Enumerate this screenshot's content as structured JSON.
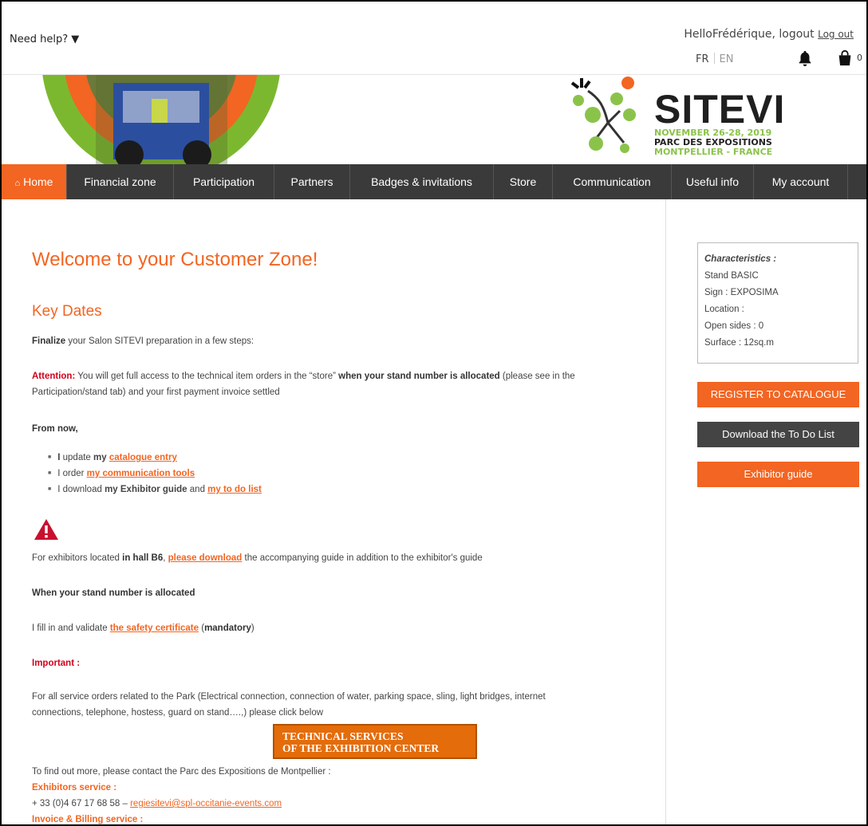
{
  "topbar": {
    "help": "Need help? ▼",
    "hello": "HelloFrédérique, logout",
    "logout": "Log out",
    "lang_fr": "FR",
    "lang_en": "EN",
    "cart_count": "0"
  },
  "logo": {
    "title": "SITEVI",
    "dates": "NOVEMBER 26-28, 2019",
    "park": "PARC DES EXPOSITIONS",
    "city": "MONTPELLIER - FRANCE"
  },
  "nav": [
    {
      "label": "Home"
    },
    {
      "label": "Financial zone"
    },
    {
      "label": "Participation"
    },
    {
      "label": "Partners"
    },
    {
      "label": "Badges & invitations"
    },
    {
      "label": "Store"
    },
    {
      "label": "Communication"
    },
    {
      "label": "Useful info"
    },
    {
      "label": "My account"
    }
  ],
  "sidebar": {
    "char_title": "Characteristics :",
    "stand": "Stand BASIC",
    "sign": "Sign : EXPOSIMA",
    "location": "Location :",
    "open_sides": "Open sides : 0",
    "surface": "Surface : 12sq.m",
    "btn_register": "REGISTER TO CATALOGUE",
    "btn_todo": "Download the To Do List",
    "btn_guide": "Exhibitor guide"
  },
  "main": {
    "welcome": "Welcome to your Customer Zone!",
    "key_dates": "Key Dates",
    "finalize_b": "Finalize",
    "finalize_rest": " your Salon SITEVI preparation in a few steps:",
    "attention_label": "Attention:",
    "attention_1": " You will get full access to the technical item orders in the “store” ",
    "attention_b": "when your stand number is allocated",
    "attention_2": " (please see in the",
    "attention_3": "Participation/stand tab) and your first payment invoice settled",
    "from_now": "From now,",
    "b1_i": "I",
    "b1_mid": " update ",
    "b1_my": "my",
    "b1_link": "catalogue entry",
    "b2_pre": "I order ",
    "b2_link": "my communication tools",
    "b3_pre": "I download ",
    "b3_b": "my Exhibitor guide",
    "b3_and": " and ",
    "b3_link": "my to do list",
    "b6_pre": "For exhibitors located ",
    "b6_b": "in hall B6",
    "b6_comma": ", ",
    "b6_link": "please download",
    "b6_rest": " the accompanying guide in addition to the exhibitor's guide",
    "allocated": "When your stand number is allocated",
    "fill_pre": "I fill in and validate ",
    "fill_link": "the safety certificate",
    "fill_mid": " (",
    "fill_b": "mandatory",
    "fill_end": ")",
    "important": "Important :",
    "service_1": "For all service orders related to the Park (Electrical connection, connection of water, parking space, sling, light bridges, internet",
    "service_2": "connections, telephone, hostess, guard on stand….,) please click below",
    "tech_1": "TECHNICAL SERVICES",
    "tech_2": "OF THE EXHIBITION CENTER",
    "contact": "To find out more, please contact the Parc des Expositions de Montpellier :",
    "exh_service": "Exhibitors service :",
    "phone": "+ 33 (0)4 67 17 68 58 – ",
    "email": "regiesitevi@spl-occitanie-events.com",
    "invoice": "Invoice & Billing service :"
  }
}
